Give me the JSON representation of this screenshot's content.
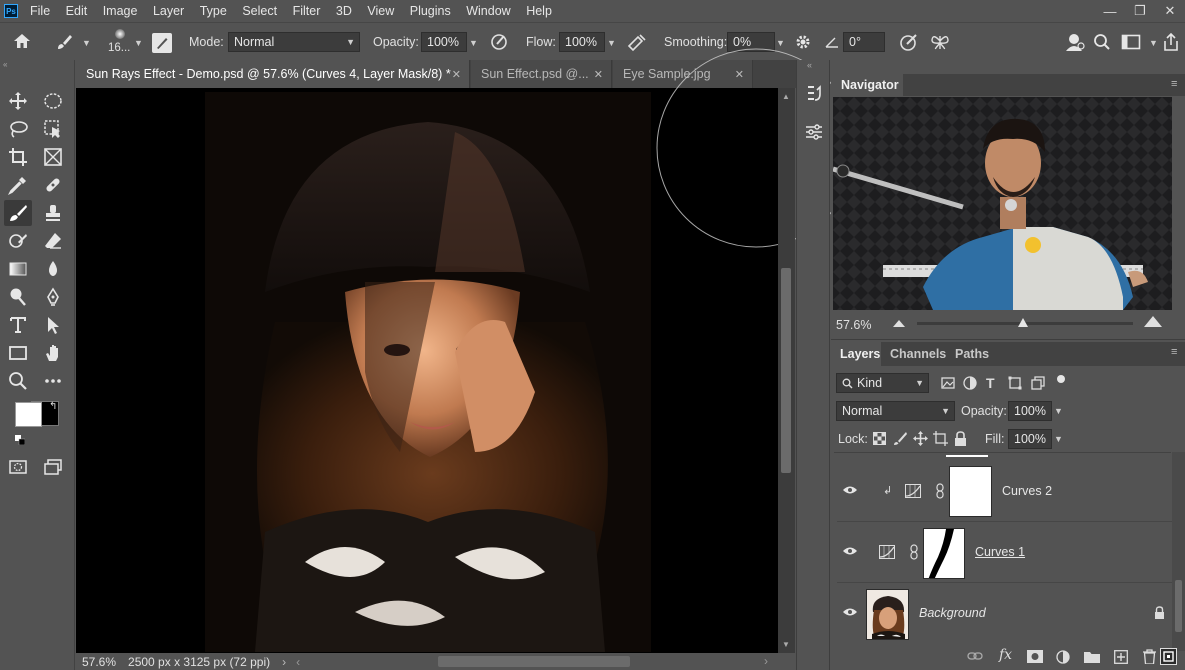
{
  "app": {
    "logo": "Ps"
  },
  "menu": [
    "File",
    "Edit",
    "Image",
    "Layer",
    "Type",
    "Select",
    "Filter",
    "3D",
    "View",
    "Plugins",
    "Window",
    "Help"
  ],
  "window_controls": {
    "minimize": "—",
    "restore": "❐",
    "close": "✕"
  },
  "options_bar": {
    "brush_size": "16...",
    "mode_label": "Mode:",
    "mode_value": "Normal",
    "opacity_label": "Opacity:",
    "opacity_value": "100%",
    "flow_label": "Flow:",
    "flow_value": "100%",
    "smoothing_label": "Smoothing:",
    "smoothing_value": "0%",
    "angle_value": "0°"
  },
  "tabs": [
    {
      "label": "Sun Rays Effect - Demo.psd @ 57.6% (Curves 4, Layer Mask/8) *",
      "active": true
    },
    {
      "label": "Sun Effect.psd @...",
      "active": false
    },
    {
      "label": "Eye Sample.jpg",
      "active": false
    }
  ],
  "status": {
    "zoom": "57.6%",
    "doc_info": "2500 px x 3125 px (72 ppi)"
  },
  "navigator": {
    "title": "Navigator",
    "zoom": "57.6%",
    "zoom_slider_position": 0.49
  },
  "layers_panel": {
    "tabs": [
      "Layers",
      "Channels",
      "Paths"
    ],
    "filter_kind": "Kind",
    "blend_mode": "Normal",
    "opacity_label": "Opacity:",
    "opacity_value": "100%",
    "lock_label": "Lock:",
    "fill_label": "Fill:",
    "fill_value": "100%",
    "layers": [
      {
        "name": "Curves 2",
        "type": "curves-adjustment",
        "clipped": true,
        "visible": true
      },
      {
        "name": "Curves 1",
        "type": "curves-adjustment",
        "clipped": false,
        "visible": true
      },
      {
        "name": "Background",
        "type": "pixel",
        "locked": true,
        "visible": true
      }
    ]
  },
  "colors": {
    "foreground": "#ffffff",
    "background": "#000000",
    "ui_bg": "#535353",
    "ui_dark": "#3c3c3c",
    "accent": "#31a8ff"
  }
}
